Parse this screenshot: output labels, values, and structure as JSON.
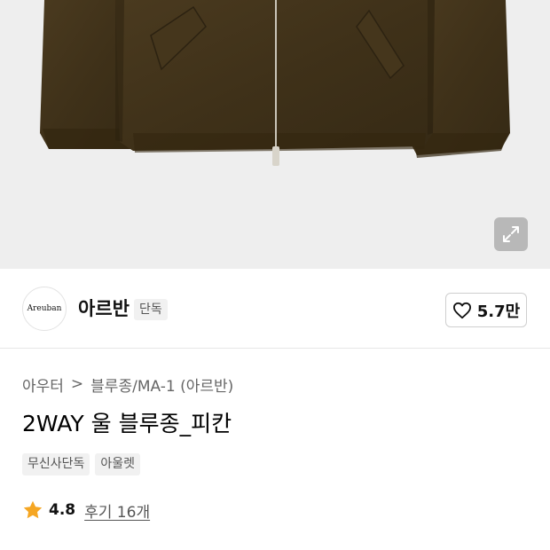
{
  "product_image": {
    "expand_icon": "expand-arrows-icon"
  },
  "brand": {
    "logo_text": "Areuban",
    "name": "아르반",
    "badge": "단독"
  },
  "like": {
    "icon": "heart-outline-icon",
    "count": "5.7만"
  },
  "breadcrumb": {
    "items": [
      "아우터",
      "블루종/MA-1 (아르반)"
    ],
    "separator": ">"
  },
  "product": {
    "title": "2WAY 울 블루종_피칸"
  },
  "tags": [
    "무신사단독",
    "아울렛"
  ],
  "rating": {
    "star_icon": "star-icon",
    "star_color": "#f5a623",
    "value": "4.8",
    "reviews_label": "후기 16개"
  }
}
